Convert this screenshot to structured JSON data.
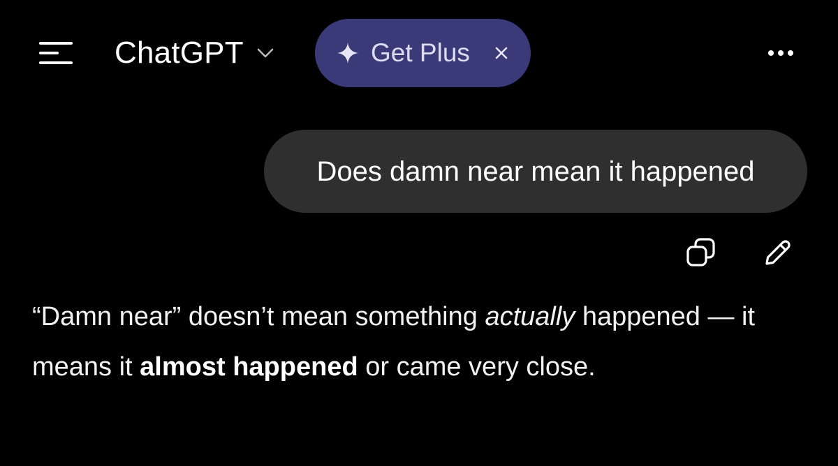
{
  "header": {
    "menu_icon": "sidebar-menu-icon",
    "model_title": "ChatGPT",
    "model_chevron_icon": "chevron-down-icon",
    "upgrade_pill": {
      "icon": "sparkle-icon",
      "label": "Get Plus",
      "close_icon": "close-icon",
      "background": "#3b3a78"
    },
    "more_icon": "more-horizontal-icon"
  },
  "conversation": {
    "user_message": "Does damn near mean it happened",
    "user_message_actions": [
      {
        "icon": "copy-icon"
      },
      {
        "icon": "edit-pencil-icon"
      }
    ],
    "assistant_reply": {
      "segments": [
        {
          "text": "“Damn near” doesn’t mean something ",
          "style": "normal"
        },
        {
          "text": "actually",
          "style": "italic"
        },
        {
          "text": " happened — it means it ",
          "style": "normal"
        },
        {
          "text": "almost happened",
          "style": "bold"
        },
        {
          "text": " or came very close.",
          "style": "normal"
        }
      ]
    }
  },
  "colors": {
    "background": "#000000",
    "bubble": "#2f2f2f",
    "text": "#ffffff"
  }
}
